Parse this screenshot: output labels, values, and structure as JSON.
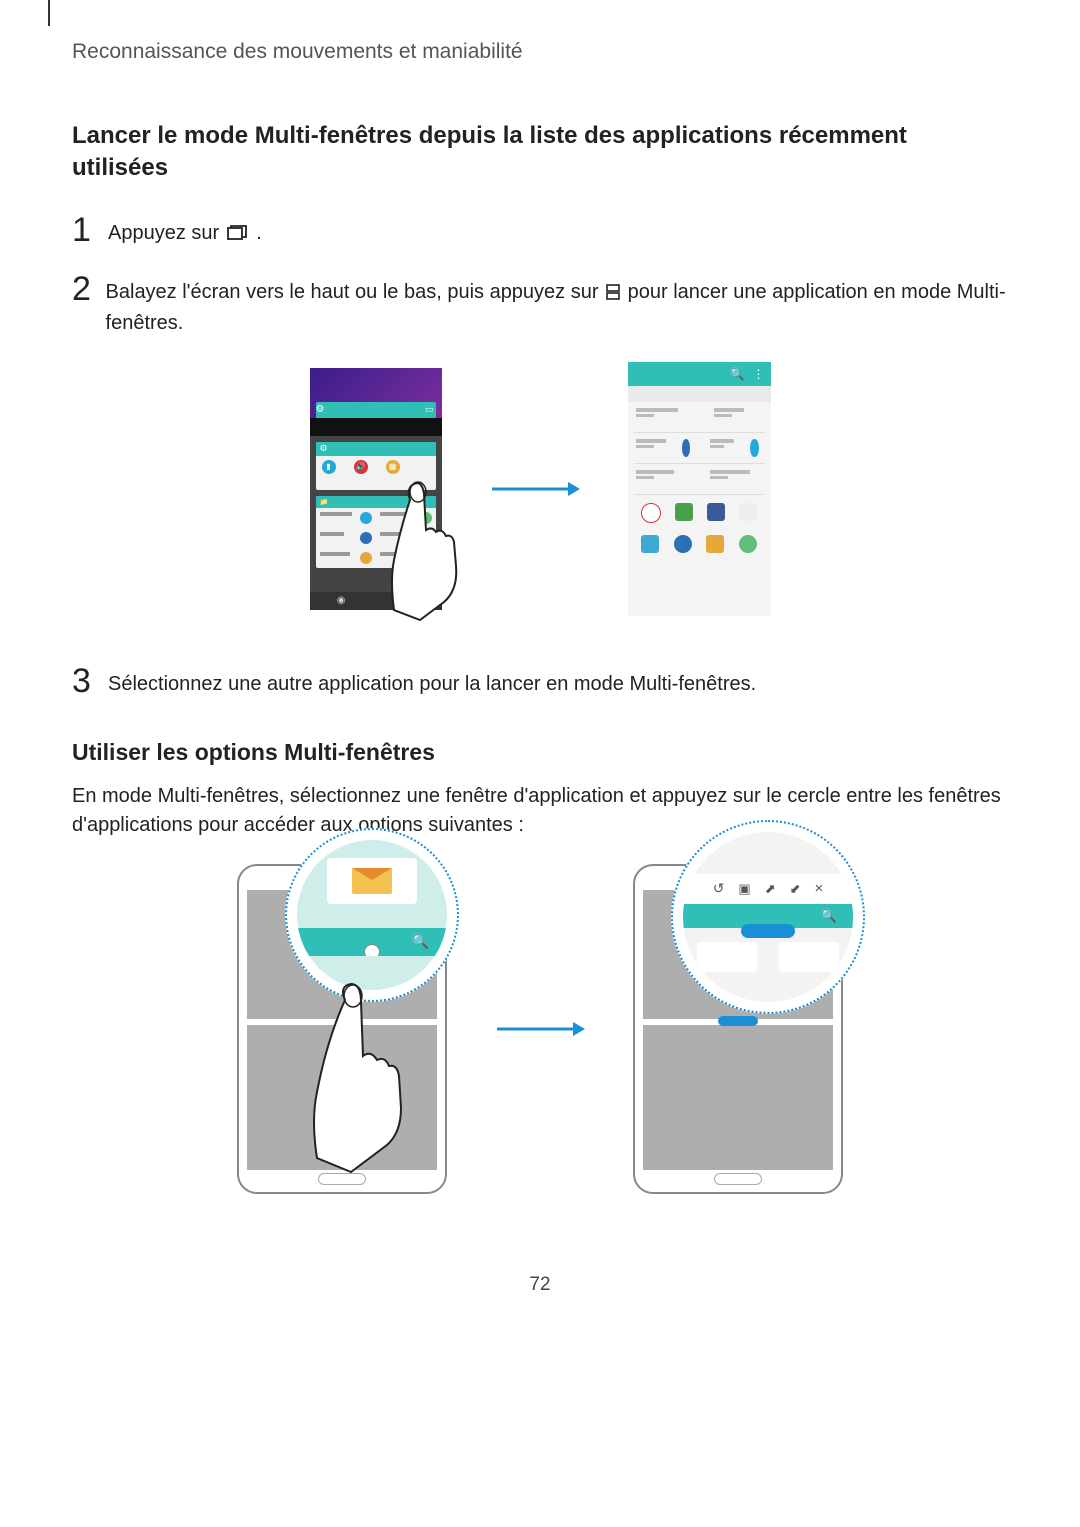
{
  "header": "Reconnaissance des mouvements et maniabilité",
  "section_title": "Lancer le mode Multi-fenêtres depuis la liste des applications récemment utilisées",
  "steps": {
    "s1": {
      "num": "1",
      "text_before": "Appuyez sur ",
      "text_after": "."
    },
    "s2": {
      "num": "2",
      "text_before": "Balayez l'écran vers le haut ou le bas, puis appuyez sur ",
      "text_after": " pour lancer une application en mode Multi-fenêtres."
    },
    "s3": {
      "num": "3",
      "text": "Sélectionnez une autre application pour la lancer en mode Multi-fenêtres."
    }
  },
  "sub_title": "Utiliser les options Multi-fenêtres",
  "body": "En mode Multi-fenêtres, sélectionnez une fenêtre d'application et appuyez sur le cercle entre les fenêtres d'applications pour accéder aux options suivantes :",
  "page_number": "72",
  "colors": {
    "teal": "#2fbfb6",
    "blue_arrow": "#1b8fd6"
  }
}
